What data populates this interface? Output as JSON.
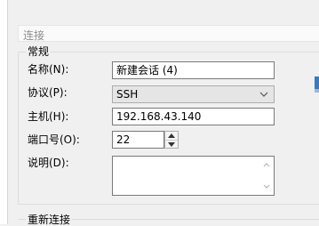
{
  "section": {
    "title": "连接"
  },
  "general": {
    "group_label": "常规",
    "name_label": "名称(N):",
    "name_value": "新建会话 (4)",
    "protocol_label": "协议(P):",
    "protocol_value": "SSH",
    "host_label": "主机(H):",
    "host_value": "192.168.43.140",
    "port_label": "端口号(O):",
    "port_value": "22",
    "description_label": "说明(D):",
    "description_value": ""
  },
  "reconnect": {
    "group_label": "重新连接"
  },
  "icons": {
    "combo_arrow": "chevron-down-icon",
    "spin_up": "spin-up-icon",
    "spin_down": "spin-down-icon",
    "side_tool": "monitor-icon"
  }
}
